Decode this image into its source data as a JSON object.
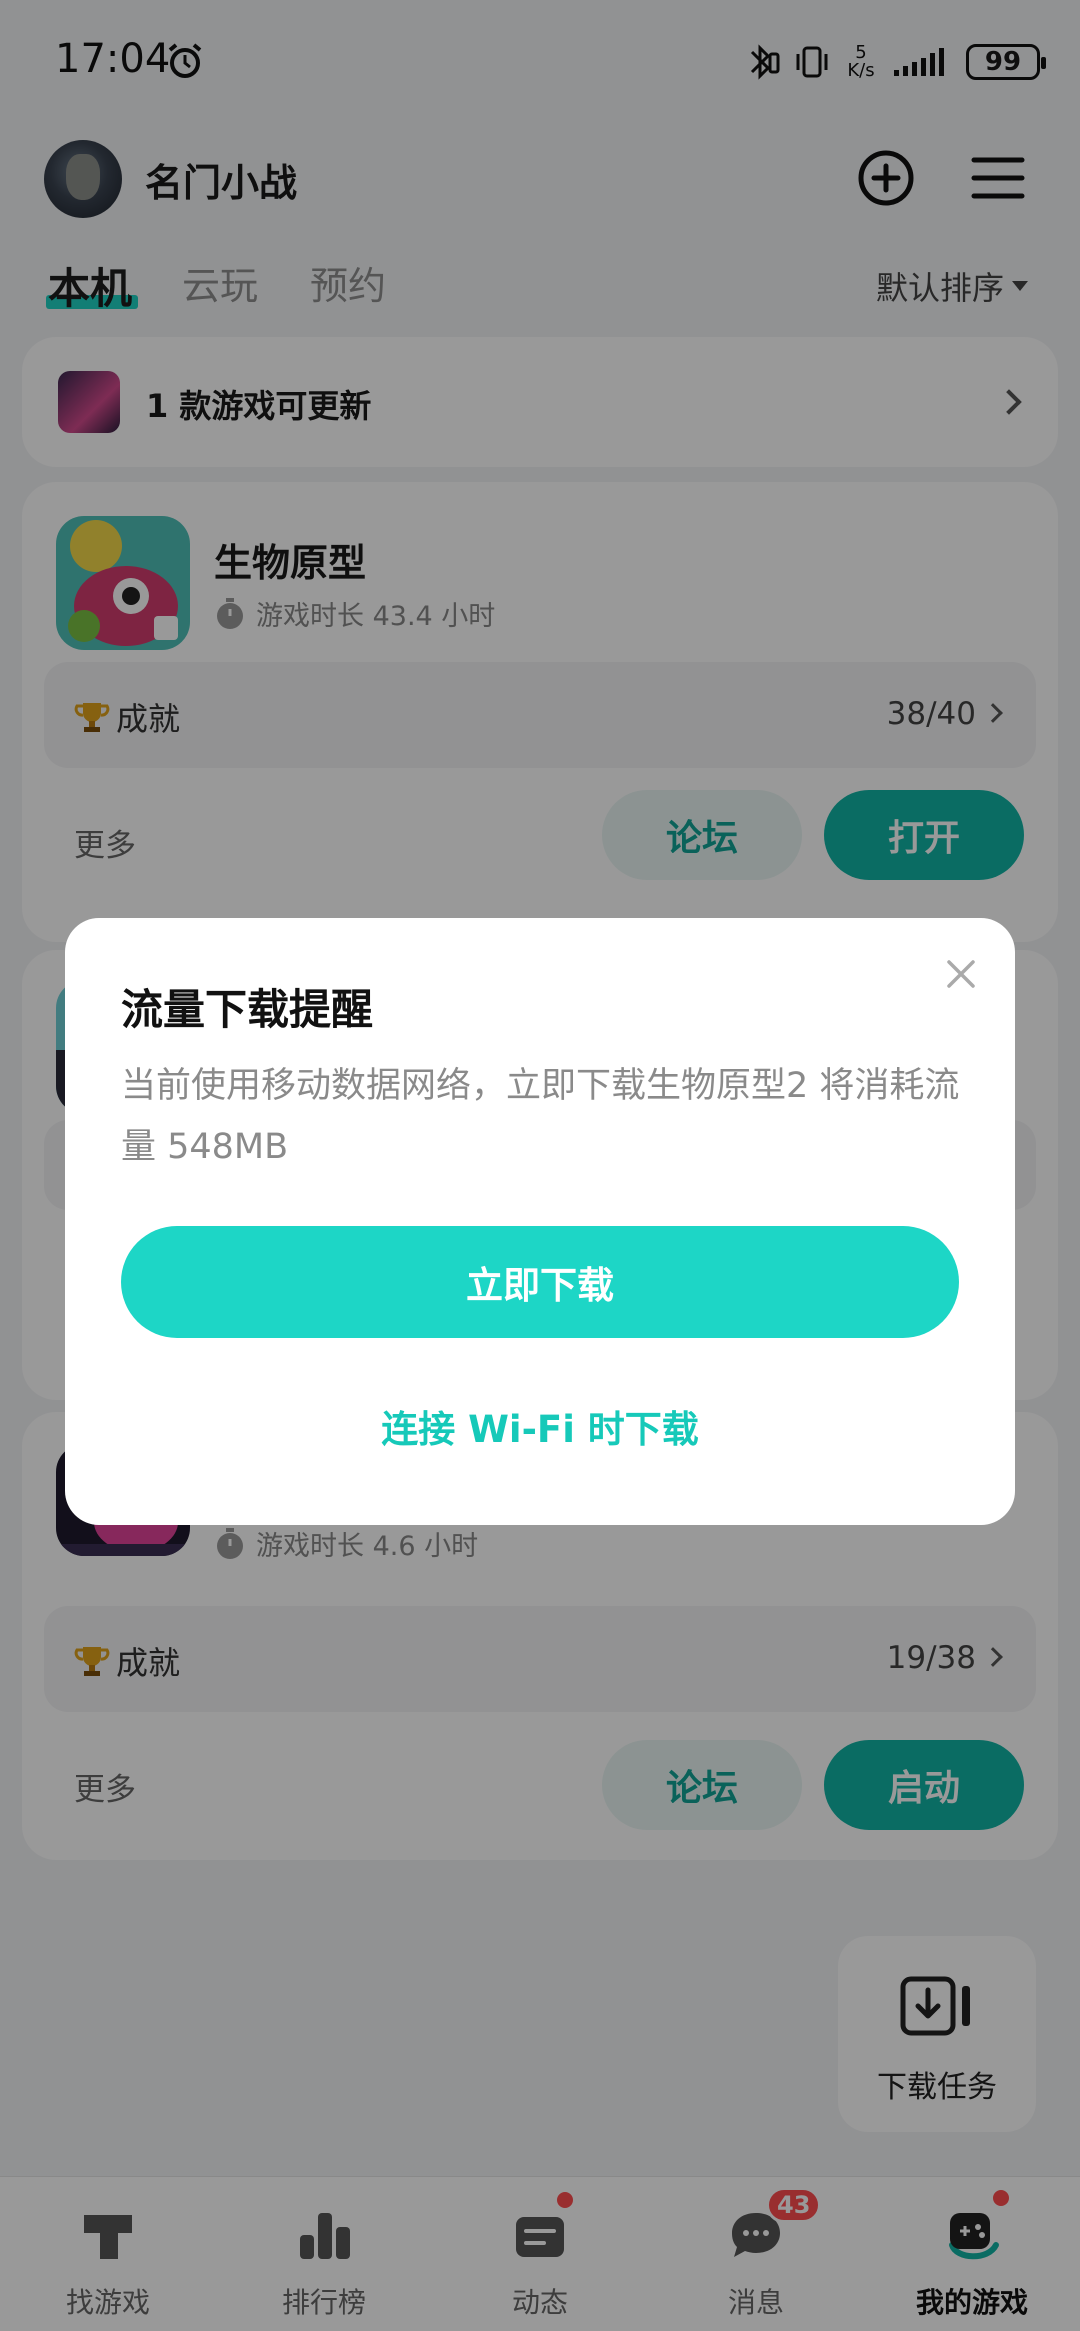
{
  "status_bar": {
    "time": "17:04",
    "net_speed_value": "5",
    "net_speed_unit": "K/s",
    "battery": "99"
  },
  "header": {
    "username": "名门小战"
  },
  "tabs": [
    {
      "label": "本机",
      "active": true
    },
    {
      "label": "云玩",
      "active": false
    },
    {
      "label": "预约",
      "active": false
    }
  ],
  "sort_label": "默认排序",
  "update_banner": {
    "text": "1 款游戏可更新"
  },
  "games": [
    {
      "title": "生物原型",
      "play_time": "游戏时长 43.4 小时",
      "achievement_label": "成就",
      "achievement_count": "38/40",
      "more_label": "更多",
      "forum_label": "论坛",
      "action_label": "打开"
    },
    {
      "title": "",
      "play_time": "游戏时长 4.6 小时",
      "achievement_label": "成就",
      "achievement_count": "19/38",
      "more_label": "更多",
      "forum_label": "论坛",
      "action_label": "启动"
    }
  ],
  "download_task": {
    "label": "下载任务"
  },
  "bottom_nav": [
    {
      "label": "找游戏",
      "icon": "find-game-icon"
    },
    {
      "label": "排行榜",
      "icon": "ranking-icon"
    },
    {
      "label": "动态",
      "icon": "feed-icon"
    },
    {
      "label": "消息",
      "icon": "message-icon",
      "badge": "43"
    },
    {
      "label": "我的游戏",
      "icon": "my-games-icon",
      "active": true
    }
  ],
  "dialog": {
    "title": "流量下载提醒",
    "message": "当前使用移动数据网络，立即下载生物原型2 将消耗流量 548MB",
    "primary_button": "立即下载",
    "secondary_button": "连接 Wi-Fi 时下载"
  },
  "colors": {
    "accent": "#1dd6c6",
    "accent_dark": "#12b5a6",
    "badge": "#ff4d4f"
  }
}
